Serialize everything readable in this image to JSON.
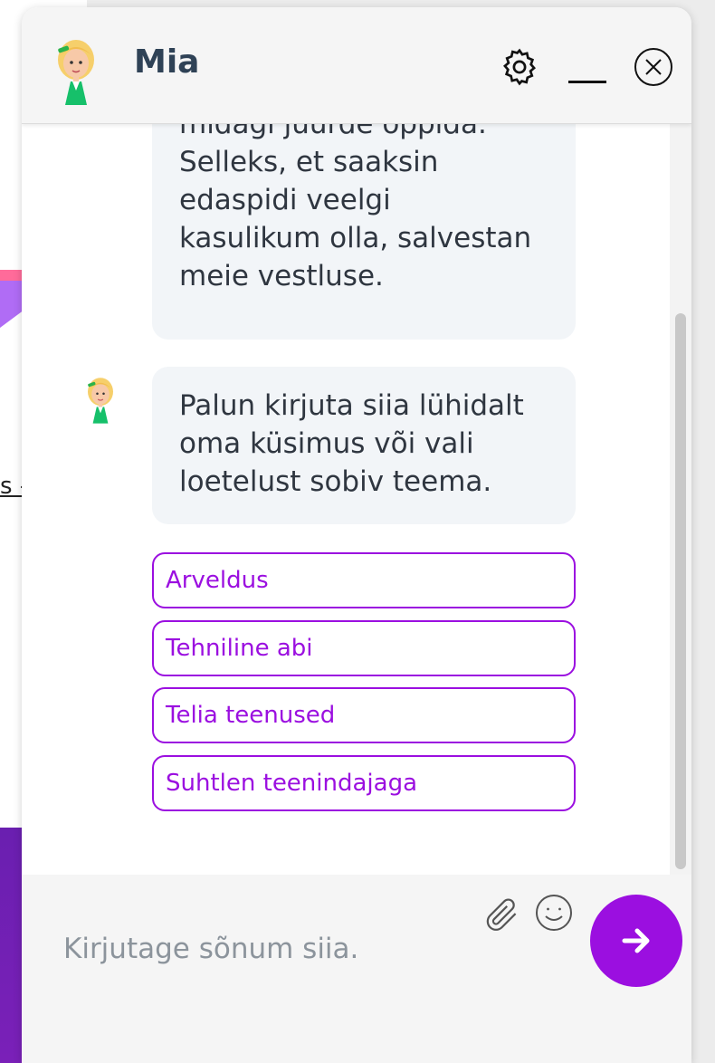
{
  "header": {
    "agent_name": "Mia"
  },
  "messages": [
    {
      "lines": [
        "midagi juurde õppida.",
        "Selleks, et saaksin",
        "edaspidi veelgi",
        "kasulikum olla, salvestan",
        "meie vestluse."
      ]
    },
    {
      "lines": [
        "Palun kirjuta siia lühidalt",
        "oma küsimus või vali",
        "loetelust sobiv teema."
      ]
    }
  ],
  "options": [
    "Arveldus",
    "Tehniline abi",
    "Telia teenused",
    "Suhtlen teenindajaga"
  ],
  "composer": {
    "placeholder": "Kirjutage sõnum siia."
  },
  "background": {
    "partial_text": "s -"
  },
  "colors": {
    "accent": "#9b0fe0",
    "agent_name": "#2f4256",
    "bubble_bg": "#f2f5f8",
    "header_bg": "#f5f5f5"
  },
  "icons": {
    "settings": "gear-icon",
    "minimize": "minimize-icon",
    "close": "close-circle-icon",
    "attach": "paperclip-icon",
    "emoji": "smiley-icon",
    "send": "arrow-right-icon"
  }
}
